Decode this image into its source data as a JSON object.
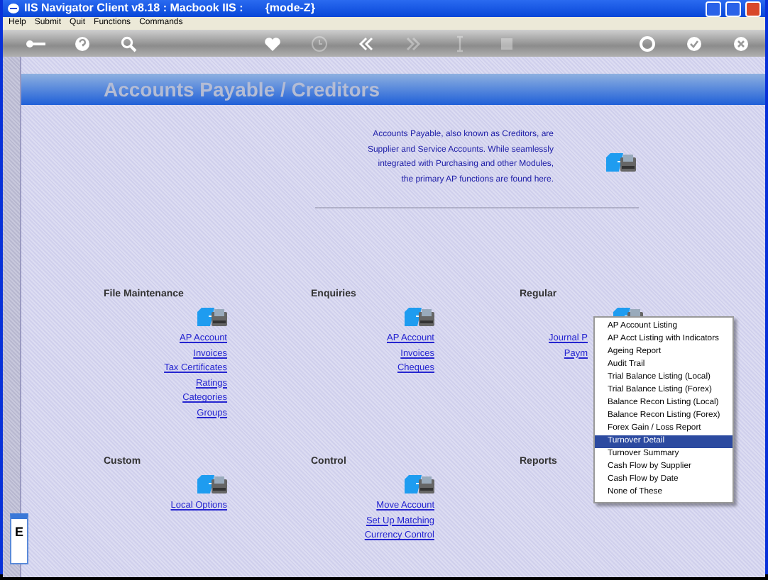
{
  "window": {
    "title": "IIS Navigator Client v8.18 : Macbook IIS :       {mode-Z}"
  },
  "menu_bar": [
    "Help",
    "Submit",
    "Quit",
    "Functions",
    "Commands"
  ],
  "toolbar": [
    {
      "kind": "key",
      "disabled": false
    },
    {
      "kind": "help",
      "disabled": false
    },
    {
      "kind": "search",
      "disabled": false
    },
    {
      "kind": "heart",
      "disabled": false
    },
    {
      "kind": "clock",
      "disabled": true
    },
    {
      "kind": "back",
      "disabled": false
    },
    {
      "kind": "forward",
      "disabled": true
    },
    {
      "kind": "cursor",
      "disabled": true
    },
    {
      "kind": "stop",
      "disabled": true
    },
    {
      "kind": "lifebuoy",
      "disabled": false
    },
    {
      "kind": "check",
      "disabled": false
    },
    {
      "kind": "close",
      "disabled": false
    }
  ],
  "page": {
    "title": "Accounts Payable / Creditors",
    "description": [
      "Accounts Payable, also known as Creditors, are",
      "Supplier and Service Accounts. While seamlessly",
      "integrated with Purchasing and other Modules,",
      "the primary AP functions are found here."
    ]
  },
  "sections": [
    {
      "heading": "File Maintenance",
      "links": [
        "AP Account",
        "Invoices",
        "Tax Certificates",
        "Ratings",
        "Categories",
        "Groups"
      ]
    },
    {
      "heading": "Enquiries",
      "links": [
        "AP Account",
        "Invoices",
        "Cheques"
      ]
    },
    {
      "heading": "Regular",
      "links": [
        "Journal P",
        "Paym"
      ]
    },
    {
      "heading": "Custom",
      "links": [
        "Local Options"
      ]
    },
    {
      "heading": "Control",
      "links": [
        "Move Account",
        "Set Up Matching",
        "Currency Control"
      ]
    },
    {
      "heading": "Reports"
    }
  ],
  "popup_menu": {
    "items": [
      {
        "label": "AP Account Listing",
        "selected": false
      },
      {
        "label": "AP Acct Listing with Indicators",
        "selected": false
      },
      {
        "label": "Ageing Report",
        "selected": false
      },
      {
        "label": "Audit Trail",
        "selected": false
      },
      {
        "label": "Trial Balance Listing (Local)",
        "selected": false
      },
      {
        "label": "Trial Balance Listing (Forex)",
        "selected": false
      },
      {
        "label": "Balance Recon Listing (Local)",
        "selected": false
      },
      {
        "label": "Balance Recon Listing (Forex)",
        "selected": false
      },
      {
        "label": "Forex Gain / Loss Report",
        "selected": false
      },
      {
        "label": "Turnover Detail",
        "selected": true
      },
      {
        "label": "Turnover Summary",
        "selected": false
      },
      {
        "label": "Cash Flow by Supplier",
        "selected": false
      },
      {
        "label": "Cash Flow by Date",
        "selected": false
      },
      {
        "label": "None of These",
        "selected": false
      }
    ]
  },
  "side_panel": {
    "label": "E"
  }
}
